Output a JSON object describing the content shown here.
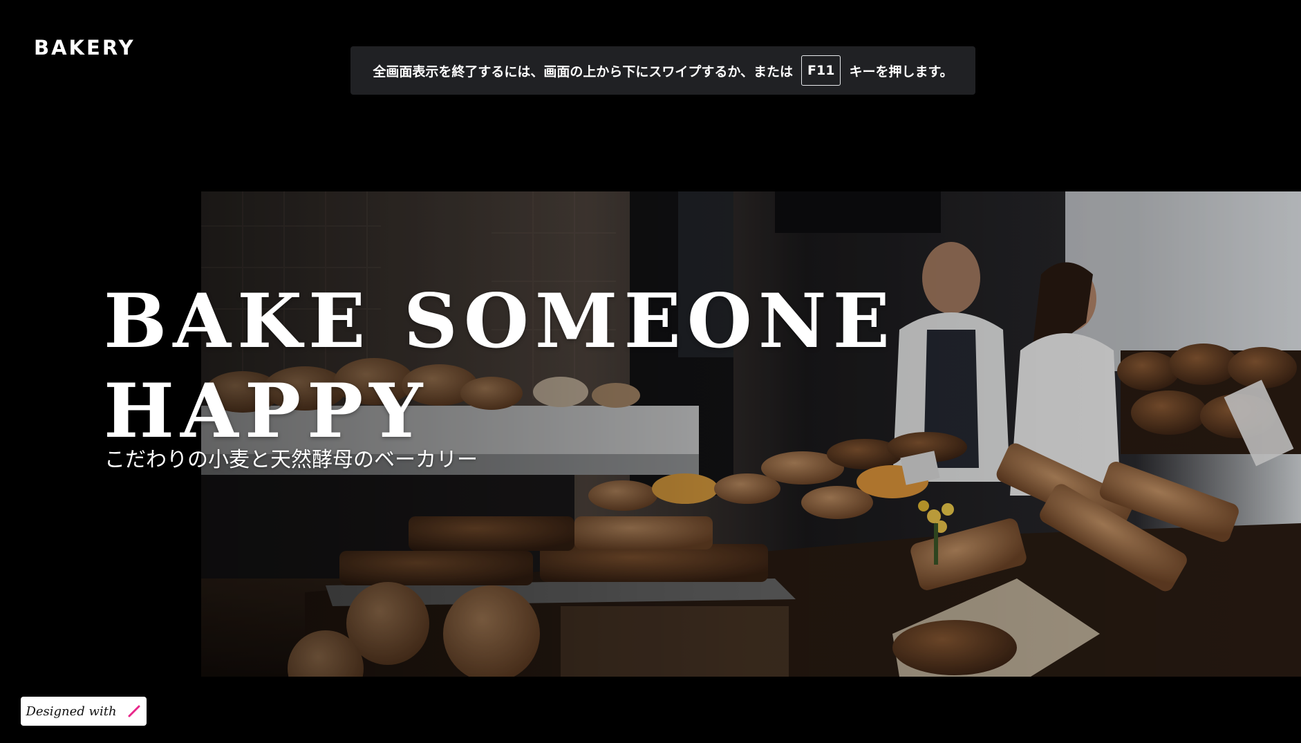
{
  "header": {
    "logo_text": "BAKERY"
  },
  "fullscreen_notice": {
    "text_before": "全画面表示を終了するには、画面の上から下にスワイプするか、または",
    "key_label": "F11",
    "text_after": "キーを押します。"
  },
  "hero": {
    "headline_line1": "BAKE SOMEONE",
    "headline_line2": "HAPPY",
    "tagline": "こだわりの小麦と天然酵母のベーカリー",
    "photo_icon": "bakery-counter-photo"
  },
  "badge": {
    "label": "Designed with",
    "icon": "pen-icon",
    "icon_color": "#e8278a"
  },
  "colors": {
    "background": "#000000",
    "banner": "#202124",
    "text": "#ffffff"
  }
}
